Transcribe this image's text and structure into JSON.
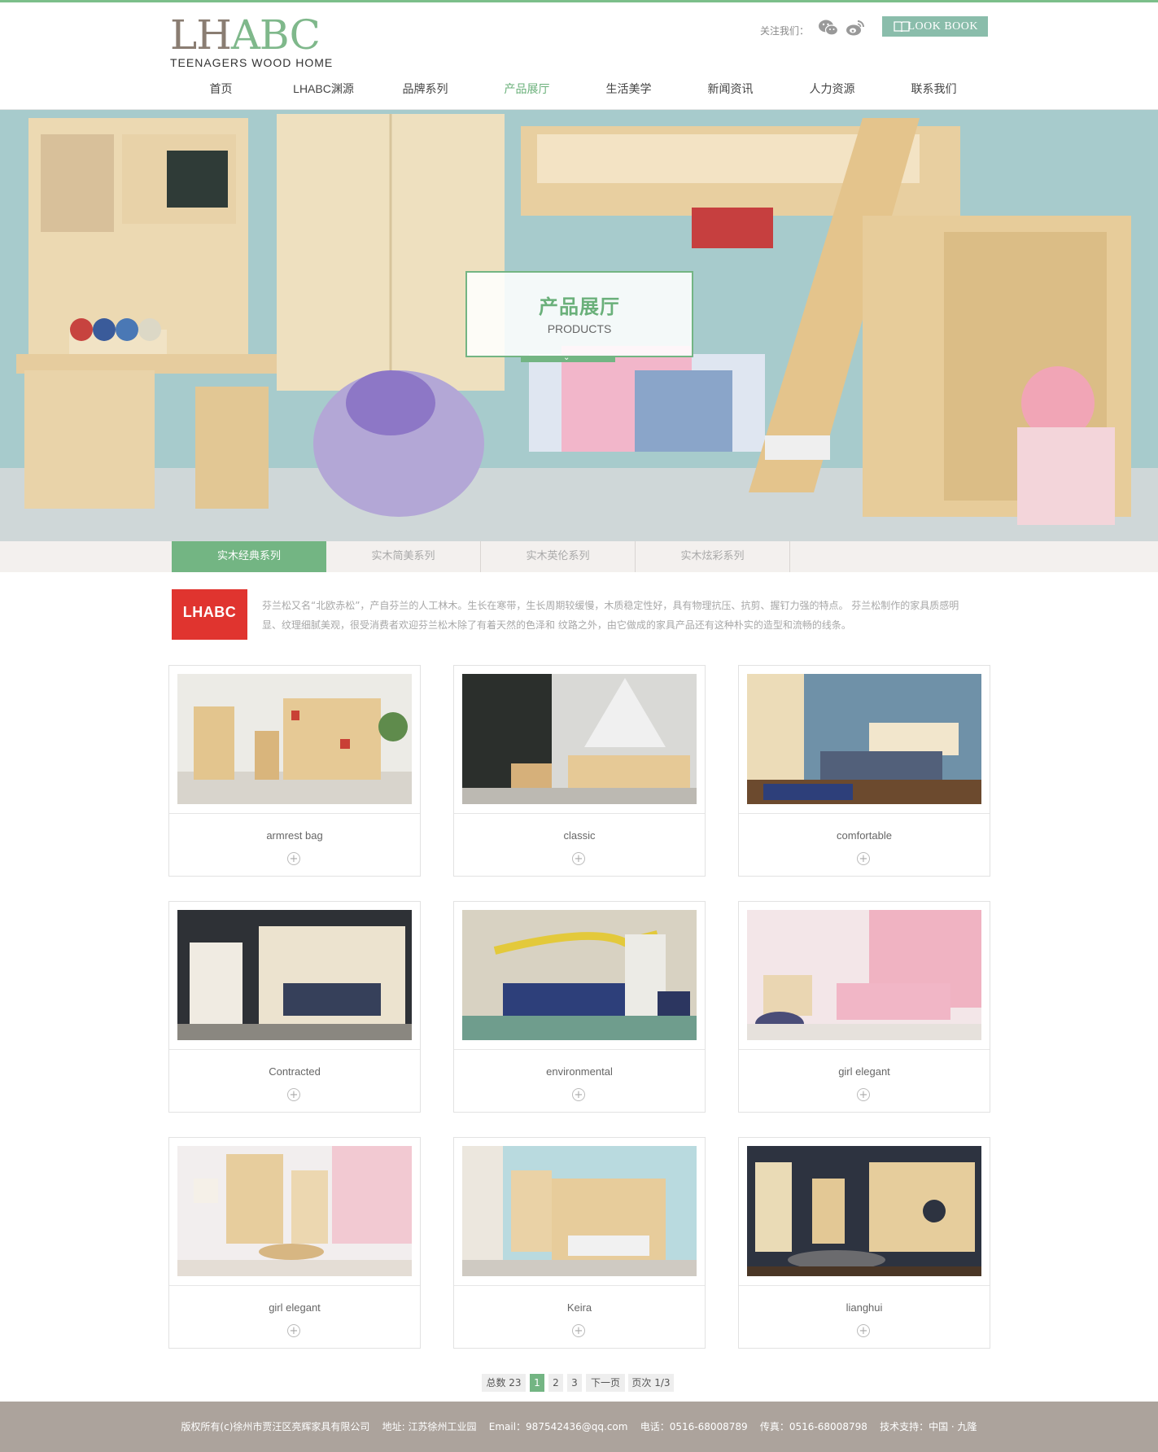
{
  "header": {
    "logo_main_1": "LH",
    "logo_main_2": "ABC",
    "logo_sub": "TEENAGERS WOOD HOME",
    "follow_label": "关注我们：",
    "social": [
      "wechat-icon",
      "weibo-icon"
    ],
    "lookbook_label": "LOOK BOOK"
  },
  "nav": {
    "items": [
      "首页",
      "LHABC渊源",
      "品牌系列",
      "产品展厅",
      "生活美学",
      "新闻资讯",
      "人力资源",
      "联系我们"
    ],
    "active_index": 3,
    "active_color": "#6ab07a"
  },
  "banner": {
    "title": "产品展厅",
    "subtitle": "PRODUCTS"
  },
  "tabs": {
    "items": [
      "实木经典系列",
      "实木简美系列",
      "实木英伦系列",
      "实木炫彩系列"
    ],
    "active_index": 0
  },
  "intro": {
    "brand": "LHABC",
    "text": "芬兰松又名“北欧赤松”，产自芬兰的人工林木。生长在寒带，生长周期较缓慢，木质稳定性好，具有物理抗压、抗剪、握钉力强的特点。 芬兰松制作的家具质感明显、纹理细腻美观，很受消费者欢迎芬兰松木除了有着天然的色泽和 纹路之外，由它做成的家具产品还有这种朴实的造型和流畅的线条。"
  },
  "products": [
    {
      "name": "armrest bag"
    },
    {
      "name": "classic"
    },
    {
      "name": "comfortable"
    },
    {
      "name": "Contracted"
    },
    {
      "name": "environmental"
    },
    {
      "name": "girl elegant"
    },
    {
      "name": "girl elegant"
    },
    {
      "name": "Keira"
    },
    {
      "name": "lianghui"
    }
  ],
  "pagination": {
    "total": "总数 23",
    "pages": [
      "1",
      "2",
      "3"
    ],
    "current": "1",
    "next": "下一页",
    "page_info": "页次 1/3"
  },
  "footer": {
    "text": "版权所有(c)徐州市贾汪区亮辉家具有限公司    地址: 江苏徐州工业园    Email：987542436@qq.com    电话：0516-68008789    传真：0516-68008798    技术支持：中国 · 九隆"
  },
  "colors": {
    "accent": "#73b583",
    "footer_bg": "#aca39c",
    "brand_red": "#e0342f"
  }
}
